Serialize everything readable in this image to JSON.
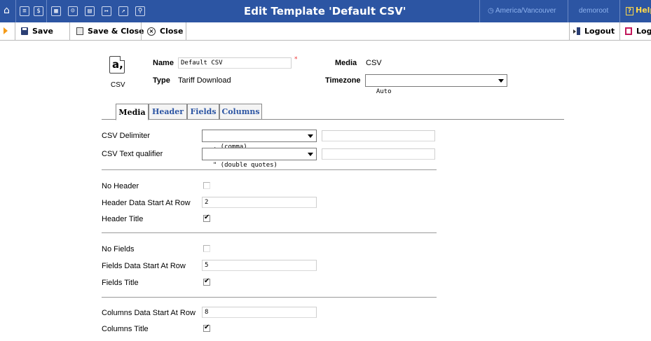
{
  "topbar": {
    "title": "Edit Template 'Default CSV'",
    "timezone": "America/Vancouver",
    "user": "demoroot",
    "help_label": "Help",
    "icons": [
      "home-icon",
      "list-icon",
      "dollar-icon",
      "grid-icon",
      "person-icon",
      "doc-icon",
      "export-icon",
      "chart-icon",
      "search-icon"
    ]
  },
  "toolbar": {
    "save_label": "Save",
    "save_close_label": "Save & Close",
    "close_label": "Close",
    "logout_label": "Logout",
    "log_label": "Log"
  },
  "header": {
    "icon_letter": "a,",
    "icon_caption": "CSV",
    "name_label": "Name",
    "name_value": "Default CSV",
    "type_label": "Type",
    "type_value": "Tariff Download",
    "media_label": "Media",
    "media_value": "CSV",
    "timezone_label": "Timezone",
    "timezone_value": "Auto"
  },
  "tabs": [
    {
      "label": "Media",
      "active": true
    },
    {
      "label": "Header",
      "active": false
    },
    {
      "label": "Fields",
      "active": false
    },
    {
      "label": "Columns",
      "active": false
    }
  ],
  "media": {
    "delimiter_label": "CSV Delimiter",
    "delimiter_value": ", (comma)",
    "qualifier_label": "CSV Text qualifier",
    "qualifier_value": "\" (double quotes)"
  },
  "header_section": {
    "no_header_label": "No Header",
    "no_header_checked": false,
    "start_row_label": "Header Data Start At Row",
    "start_row_value": "2",
    "title_label": "Header Title",
    "title_checked": true
  },
  "fields_section": {
    "no_fields_label": "No Fields",
    "no_fields_checked": false,
    "start_row_label": "Fields Data Start At Row",
    "start_row_value": "5",
    "title_label": "Fields Title",
    "title_checked": true
  },
  "columns_section": {
    "start_row_label": "Columns Data Start At Row",
    "start_row_value": "8",
    "title_label": "Columns Title",
    "title_checked": true
  }
}
